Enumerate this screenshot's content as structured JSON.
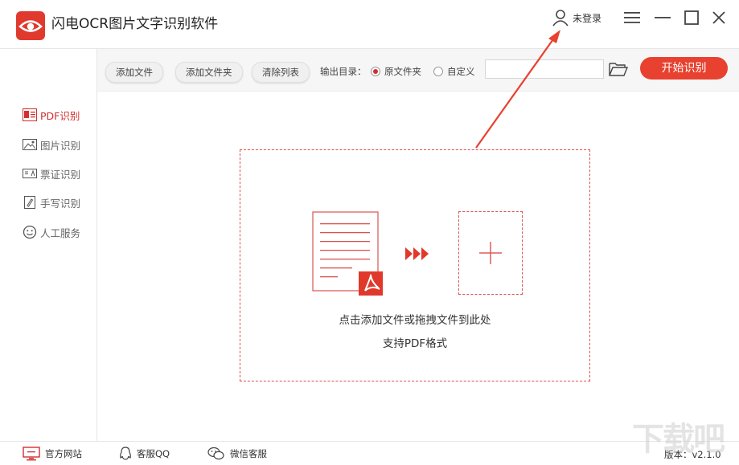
{
  "app": {
    "title": "闪电OCR图片文字识别软件",
    "brand_color": "#e03a2e"
  },
  "header": {
    "login_label": "未登录",
    "icons": [
      "user-icon",
      "menu-icon",
      "minimize-icon",
      "maximize-icon",
      "close-icon"
    ]
  },
  "sidebar": {
    "items": [
      {
        "label": "PDF识别",
        "icon": "pdf-icon",
        "active": true
      },
      {
        "label": "图片识别",
        "icon": "image-icon",
        "active": false
      },
      {
        "label": "票证识别",
        "icon": "ticket-icon",
        "active": false
      },
      {
        "label": "手写识别",
        "icon": "handwriting-icon",
        "active": false
      },
      {
        "label": "人工服务",
        "icon": "smiley-icon",
        "active": false
      }
    ]
  },
  "toolbar": {
    "add_file": "添加文件",
    "add_folder": "添加文件夹",
    "clear_list": "清除列表",
    "output_label": "输出目录：",
    "radio_original": "原文件夹",
    "radio_custom": "自定义",
    "selected_output": "原文件夹",
    "path_value": "",
    "start": "开始识别"
  },
  "dropzone": {
    "hint_line1": "点击添加文件或拖拽文件到此处",
    "hint_line2": "支持PDF格式"
  },
  "footer": {
    "website": "官方网站",
    "qq": "客服QQ",
    "wechat": "微信客服",
    "version": "版本：v2.1.0"
  },
  "watermark": "下载吧"
}
